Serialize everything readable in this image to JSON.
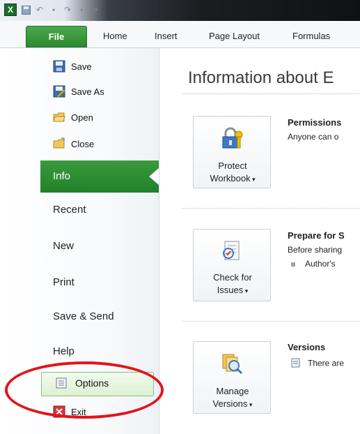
{
  "ribbon": {
    "tabs": [
      "File",
      "Home",
      "Insert",
      "Page Layout",
      "Formulas"
    ]
  },
  "backstage": {
    "commands_top": [
      "Save",
      "Save As",
      "Open",
      "Close"
    ],
    "selected": "Info",
    "nav": [
      "Recent",
      "New",
      "Print",
      "Save & Send",
      "Help"
    ],
    "commands_bottom": [
      "Options",
      "Exit"
    ]
  },
  "content": {
    "heading": "Information about E",
    "sections": [
      {
        "button_line1": "Protect",
        "button_line2": "Workbook",
        "title": "Permissions",
        "text": "Anyone can o"
      },
      {
        "button_line1": "Check for",
        "button_line2": "Issues",
        "title": "Prepare for S",
        "text": "Before sharing",
        "bullet": "Author's"
      },
      {
        "button_line1": "Manage",
        "button_line2": "Versions",
        "title": "Versions",
        "text": "There are"
      }
    ]
  },
  "colors": {
    "file_tab": "#2b8a2d",
    "info_selected": "#23802a",
    "annotation": "#e4131a"
  }
}
